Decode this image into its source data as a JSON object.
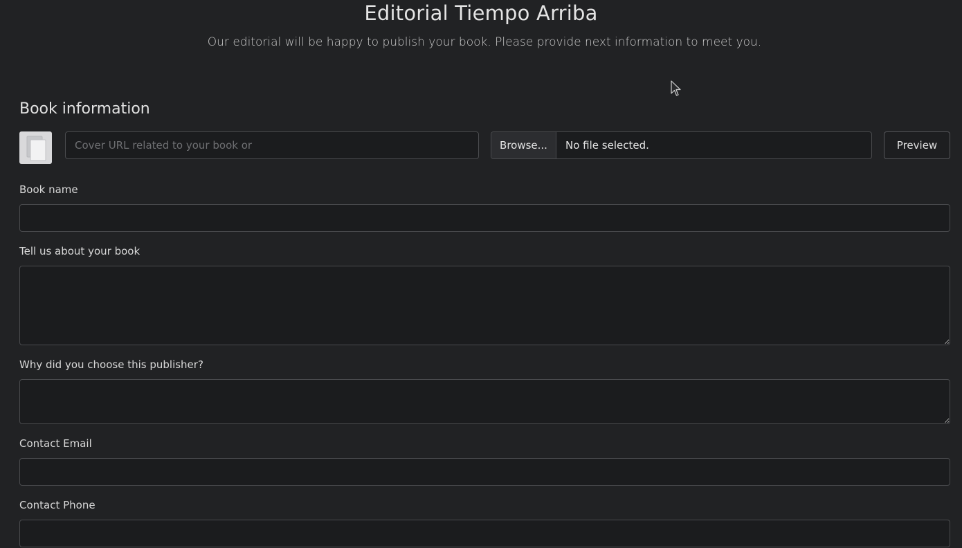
{
  "header": {
    "title": "Editorial Tiempo Arriba",
    "subtitle": "Our editorial will be happy to publish your book. Please provide next information to meet you."
  },
  "book_section": {
    "title": "Book information",
    "cover_url_placeholder": "Cover URL related to your book or",
    "browse_label": "Browse...",
    "file_status": "No file selected.",
    "preview_label": "Preview"
  },
  "fields": {
    "book_name": {
      "label": "Book name",
      "value": ""
    },
    "about_book": {
      "label": "Tell us about your book",
      "value": ""
    },
    "why_publisher": {
      "label": "Why did you choose this publisher?",
      "value": ""
    },
    "contact_email": {
      "label": "Contact Email",
      "value": ""
    },
    "contact_phone": {
      "label": "Contact Phone",
      "value": ""
    }
  },
  "icons": {
    "cover": "image-placeholder-icon",
    "cursor": "mouse-pointer-icon"
  },
  "colors": {
    "background": "#212224",
    "input_background": "#1b1c1e",
    "input_border": "#4a4b4e",
    "text": "#dcdcdc"
  }
}
